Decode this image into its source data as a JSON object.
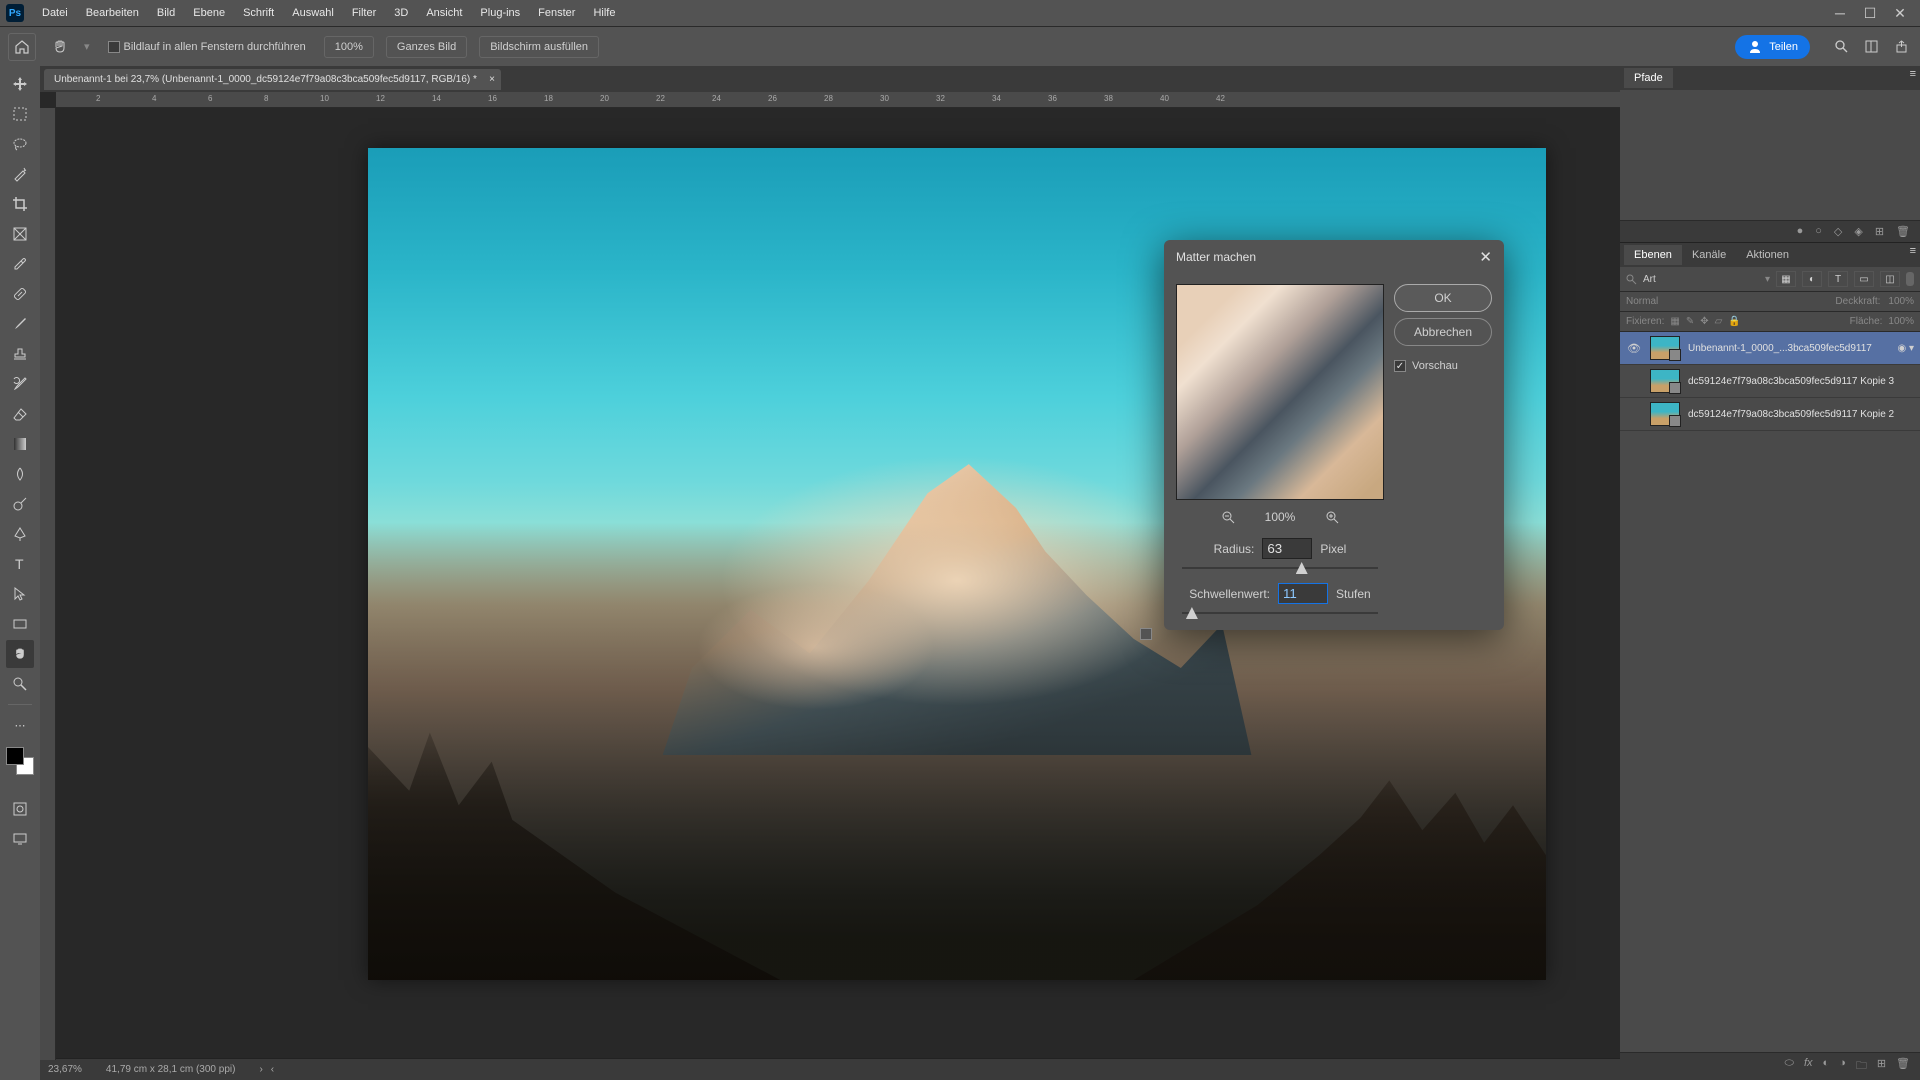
{
  "menu": {
    "items": [
      "Datei",
      "Bearbeiten",
      "Bild",
      "Ebene",
      "Schrift",
      "Auswahl",
      "Filter",
      "3D",
      "Ansicht",
      "Plug-ins",
      "Fenster",
      "Hilfe"
    ]
  },
  "options": {
    "bildlauf": "Bildlauf in allen Fenstern durchführen",
    "zoom": "100%",
    "ganzes_bild": "Ganzes Bild",
    "bildschirm": "Bildschirm ausfüllen",
    "share": "Teilen"
  },
  "document": {
    "tab_title": "Unbenannt-1 bei 23,7% (Unbenannt-1_0000_dc59124e7f79a08c3bca509fec5d9117, RGB/16) *",
    "status_zoom": "23,67%",
    "status_dims": "41,79 cm x 28,1 cm (300 ppi)"
  },
  "ruler_marks": [
    "2",
    "4",
    "6",
    "8",
    "10",
    "12",
    "14",
    "16",
    "18",
    "20",
    "22",
    "24",
    "26",
    "28",
    "30",
    "32",
    "34",
    "36",
    "38",
    "40",
    "42"
  ],
  "dialog": {
    "title": "Matter machen",
    "ok": "OK",
    "cancel": "Abbrechen",
    "preview": "Vorschau",
    "zoom": "100%",
    "radius_label": "Radius:",
    "radius_value": "63",
    "radius_unit": "Pixel",
    "threshold_label": "Schwellenwert:",
    "threshold_value": "11",
    "threshold_unit": "Stufen"
  },
  "panels": {
    "paths_tab": "Pfade",
    "layers_tabs": [
      "Ebenen",
      "Kanäle",
      "Aktionen"
    ],
    "filter_placeholder": "Art",
    "blend_mode": "Normal",
    "opacity_label": "Deckkraft:",
    "opacity_value": "100%",
    "lock_label": "Fixieren:",
    "fill_label": "Fläche:",
    "fill_value": "100%",
    "layers": [
      {
        "name": "Unbenannt-1_0000_...3bca509fec5d9117",
        "visible": true,
        "selected": true,
        "smart": true
      },
      {
        "name": "dc59124e7f79a08c3bca509fec5d9117 Kopie 3",
        "visible": false,
        "selected": false,
        "smart": false
      },
      {
        "name": "dc59124e7f79a08c3bca509fec5d9117 Kopie 2",
        "visible": false,
        "selected": false,
        "smart": false
      }
    ]
  }
}
